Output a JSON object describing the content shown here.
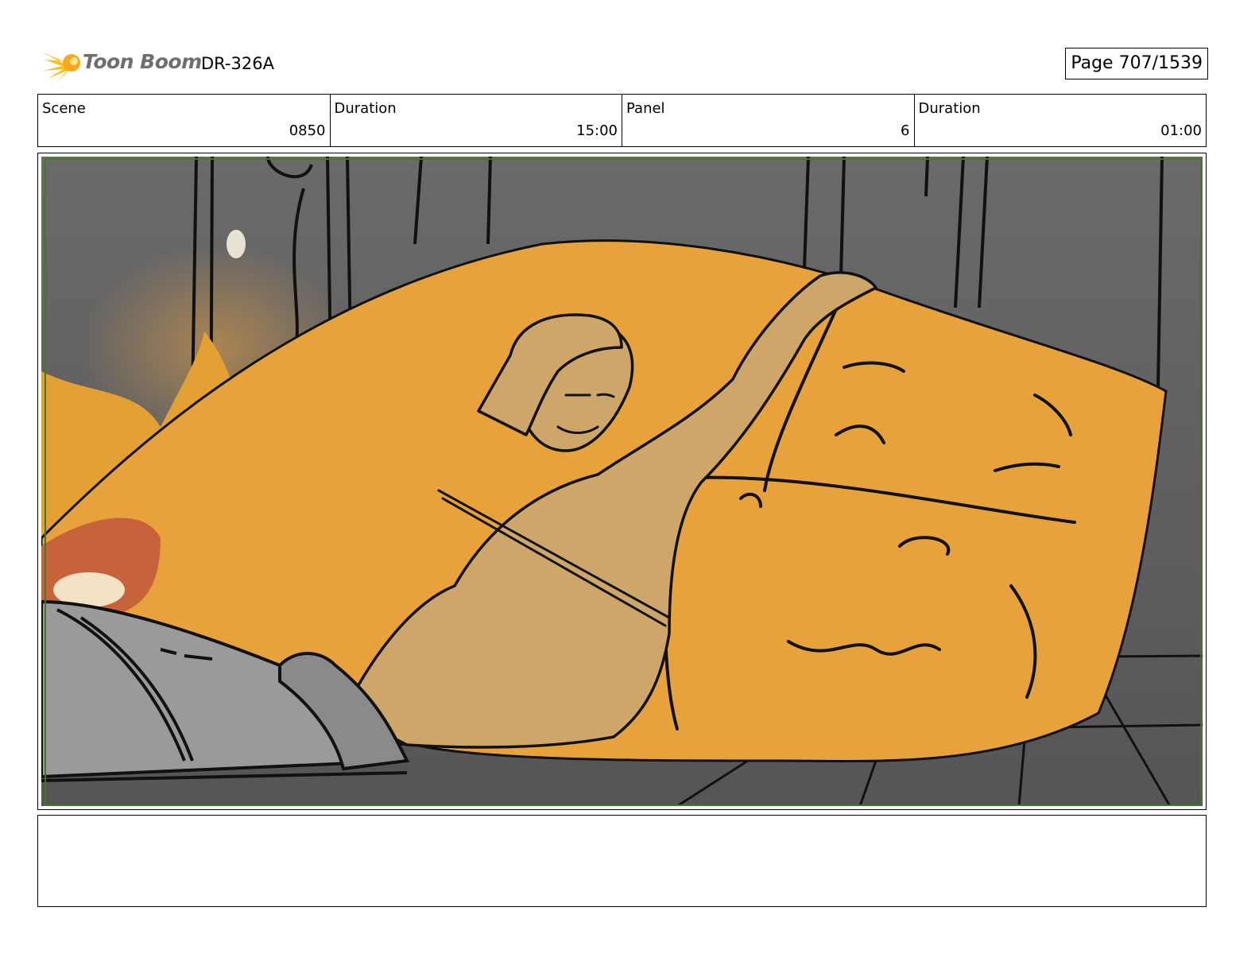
{
  "header": {
    "brand": "Toon Boom",
    "project_code": "DR-326A",
    "page_label": "Page",
    "page_value": "707/1539"
  },
  "info": {
    "scene_label": "Scene",
    "scene_value": "0850",
    "scene_duration_label": "Duration",
    "scene_duration_value": "15:00",
    "panel_label": "Panel",
    "panel_value": "6",
    "panel_duration_label": "Duration",
    "panel_duration_value": "01:00"
  },
  "colors": {
    "background_gray": "#5f5f5f",
    "orange_body": "#e8a23c",
    "character_skin": "#cfa66a",
    "machine_gray": "#9a9a9a",
    "safe_frame": "#3a7a2a"
  },
  "notes": ""
}
